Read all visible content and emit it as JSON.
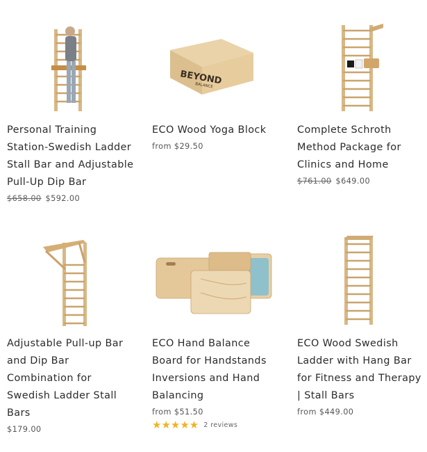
{
  "products": [
    {
      "title_lines": [
        "Personal Training",
        "Station-Swedish Ladder",
        "Stall Bar and Adjustable",
        "Pull-Up Dip Bar"
      ],
      "old_price": "$658.00",
      "price": "$592.00"
    },
    {
      "title_lines": [
        "ECO Wood Yoga Block"
      ],
      "price": "from $29.50",
      "logo_text_main": "BEYOND",
      "logo_text_sub": "BALANCE"
    },
    {
      "title_lines": [
        "Complete Schroth",
        "Method Package for",
        "Clinics and Home"
      ],
      "old_price": "$761.00",
      "price": "$649.00"
    },
    {
      "title_lines": [
        "Adjustable Pull-up Bar",
        "and Dip Bar",
        "Combination for",
        "Swedish Ladder Stall",
        "Bars"
      ],
      "price": "$179.00"
    },
    {
      "title_lines": [
        "ECO Hand Balance",
        "Board for Handstands",
        "Inversions and Hand",
        "Balancing"
      ],
      "price": "from $51.50",
      "stars": "★★★★★",
      "reviews": "2 reviews"
    },
    {
      "title_lines": [
        "ECO Wood Swedish",
        "Ladder with Hang Bar",
        "for Fitness and Therapy",
        "| Stall Bars"
      ],
      "price": "from $449.00"
    }
  ],
  "colors": {
    "wood": "#e3c79a",
    "wood_dark": "#b8925a",
    "star": "#f2b321",
    "board_blue": "#8fc1cc"
  }
}
